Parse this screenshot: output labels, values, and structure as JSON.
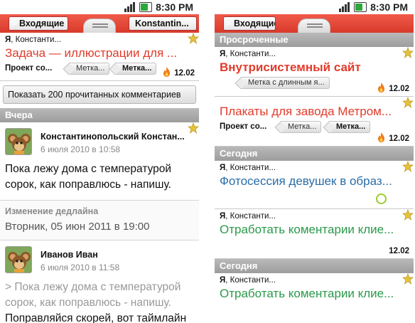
{
  "status": {
    "time": "8:30 PM"
  },
  "left": {
    "header": {
      "back_label": "Входящие",
      "fwd_label": "Konstantin..."
    },
    "task": {
      "author_bold": "Я",
      "author_rest": ", Константи...",
      "title": "Задача — иллюстрации для ...",
      "project": "Проект со...",
      "tag1": "Метка...",
      "tag2": "Метка...",
      "date": "12.02"
    },
    "show_more_label": "Показать 200 прочитанных комментариев",
    "section": "Вчера",
    "comments": [
      {
        "name": "Константинопольский Констан...",
        "date": "6 июля 2010 в 10:58",
        "text": "Пока лежу дома с температурой сорок, как поправлюсь - напишу."
      },
      {
        "name": "Иванов Иван",
        "date": "6 июля 2010 в 11:58",
        "quote": "> Пока лежу дома с температурой сорок, как поправлюсь - напишу.",
        "text": "Поправляйся скорей, вот таймлайн"
      }
    ],
    "system": {
      "label": "Изменение дедлайна",
      "value": "Вторник, 05 июн 2011 в 19:00"
    }
  },
  "right": {
    "header": {
      "back_label": "Входящие"
    },
    "sections": {
      "overdue": "Просроченные",
      "today1": "Сегодня",
      "today2": "Сегодня"
    },
    "tasks": [
      {
        "author_bold": "Я",
        "author_rest": ", Константи...",
        "title": "Внутрисистемный сайт",
        "tag_long": "Метка с длинным я...",
        "date": "12.02"
      },
      {
        "title": "Плакаты для завода Метром...",
        "project": "Проект со...",
        "tag1": "Метка...",
        "tag2": "Метка...",
        "date": "12.02"
      },
      {
        "author_bold": "Я",
        "author_rest": ", Константи...",
        "title": "Фотосессия девушек в образ..."
      },
      {
        "author_bold": "Я",
        "author_rest": ", Константи...",
        "title": "Отработать коментарии клие...",
        "date": "12.02"
      },
      {
        "author_bold": "Я",
        "author_rest": ", Константи...",
        "title": "Отработать коментарии клие..."
      }
    ]
  },
  "colors": {
    "accent": "#e23b2b",
    "section": "#a8a8a8",
    "link_blue": "#2a6ea8",
    "green": "#2a9a4a",
    "flame": "#f07a1a",
    "star": "#e6c23a"
  },
  "icons": [
    "signal-icon",
    "battery-icon",
    "star-icon",
    "flame-icon",
    "avatar-cheburashka",
    "circle-status-icon",
    "handle-icon"
  ]
}
